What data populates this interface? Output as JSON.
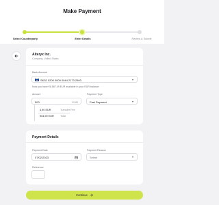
{
  "page": {
    "title": "Make Payment"
  },
  "stepper": {
    "steps": [
      {
        "label": "Select Counterparty",
        "state": "done"
      },
      {
        "label": "Enter Details",
        "state": "current"
      },
      {
        "label": "Review & Submit",
        "state": "todo"
      }
    ],
    "accent": "#c9e13c"
  },
  "payee": {
    "name": "Alteryx Inc.",
    "type_location": "Company, United States"
  },
  "transfer": {
    "bank_account_label": "Bank Account",
    "bank_account_value": "SK52 0200 0000 0044 2173 2993",
    "account_flag": "eu-flag-icon",
    "balance_note": "Now you have €6,587.49 EUR available in your EUR balance",
    "amount_label": "Amount",
    "amount_value": "500",
    "amount_currency": "EUR",
    "payment_type_label": "Payment Type",
    "payment_type_value": "Fast Payment",
    "fee_value": "4,90 EUR",
    "fee_label": "Transfer Fee",
    "total_value": "504,90 EUR",
    "total_label": "Total"
  },
  "details": {
    "section_title": "Payment Details",
    "payment_date_label": "Payment Date",
    "payment_date_value": "07/02/2023",
    "payment_reason_label": "Payment Reason",
    "payment_reason_value": "Select",
    "reference_label": "Reference",
    "reference_value": ""
  },
  "actions": {
    "continue_label": "Continue",
    "button_color": "#cfe34a"
  }
}
